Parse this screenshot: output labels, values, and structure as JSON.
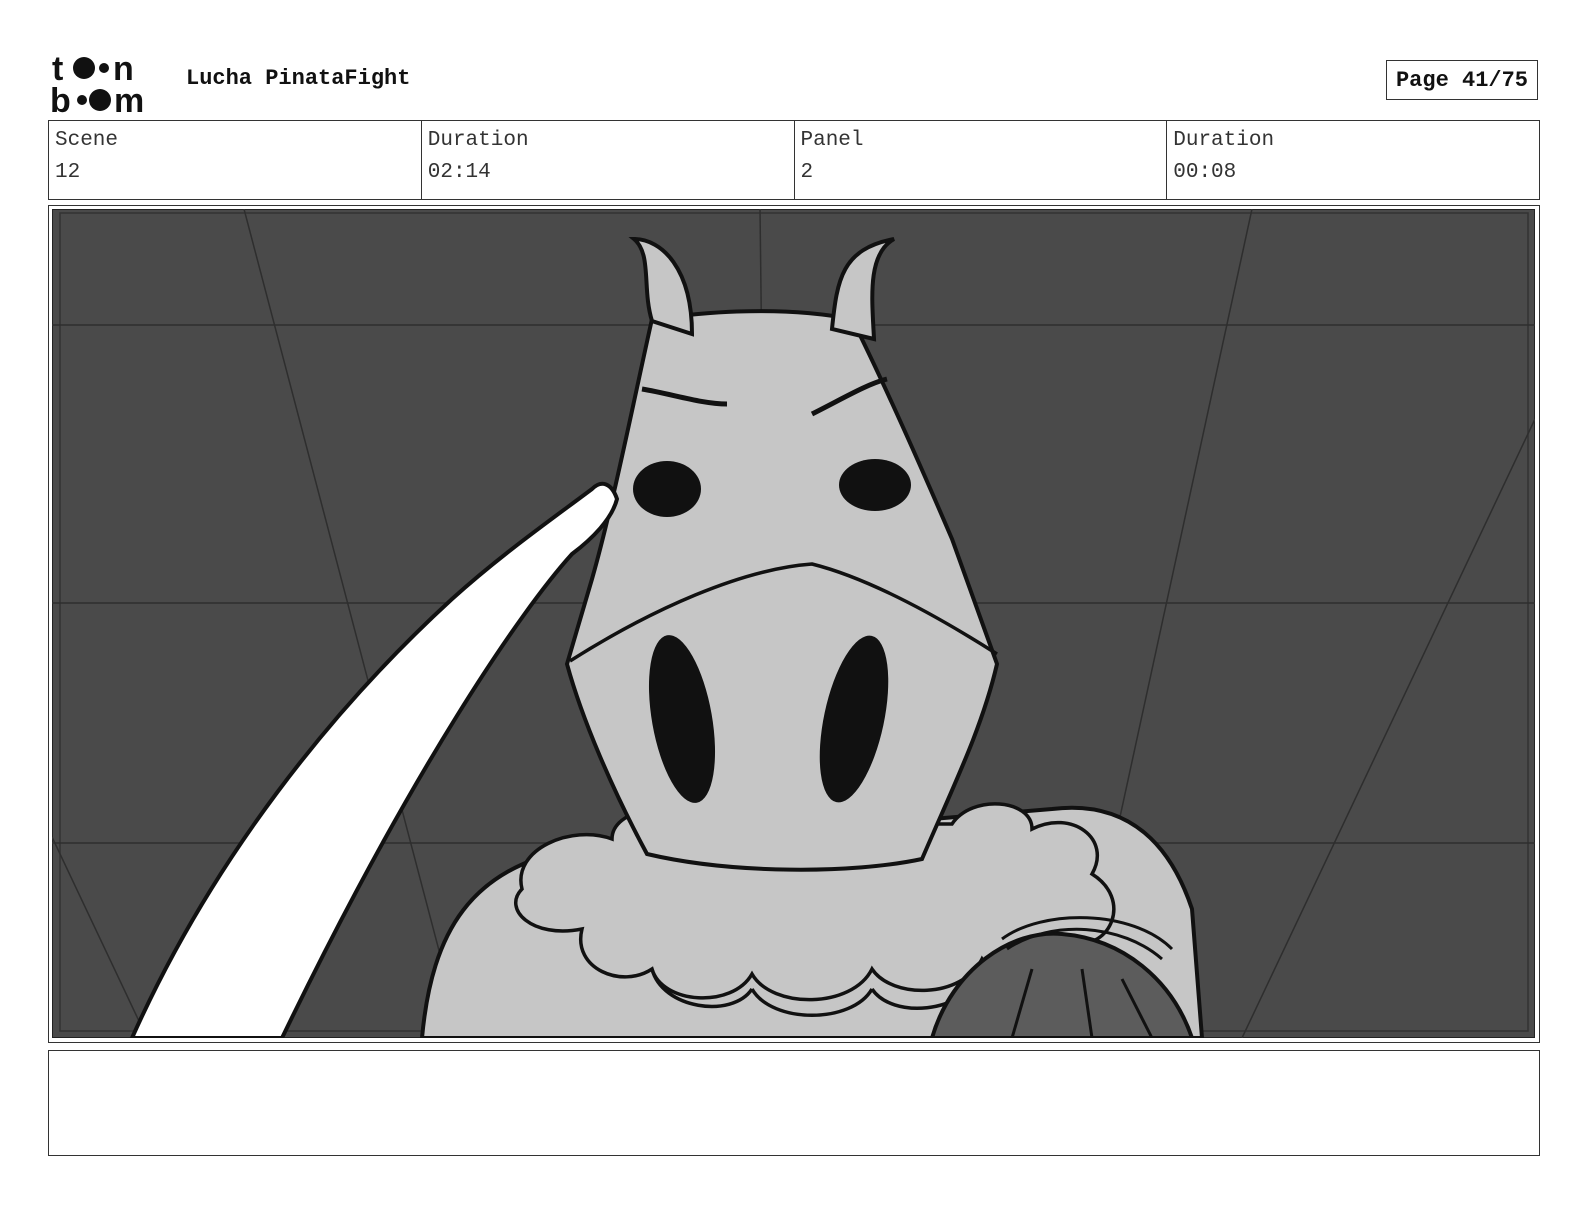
{
  "header": {
    "logo_text": "toonboom",
    "project_title": "Lucha PinataFight",
    "page_label": "Page 41/75"
  },
  "info": {
    "scene_label": "Scene",
    "scene_value": "12",
    "scene_duration_label": "Duration",
    "scene_duration_value": "02:14",
    "panel_label": "Panel",
    "panel_value": "2",
    "panel_duration_label": "Duration",
    "panel_duration_value": "00:08"
  },
  "notes": {
    "text": ""
  },
  "colors": {
    "background_dark": "#4a4a4a",
    "character_fill": "#c6c6c6",
    "ink": "#111111"
  }
}
